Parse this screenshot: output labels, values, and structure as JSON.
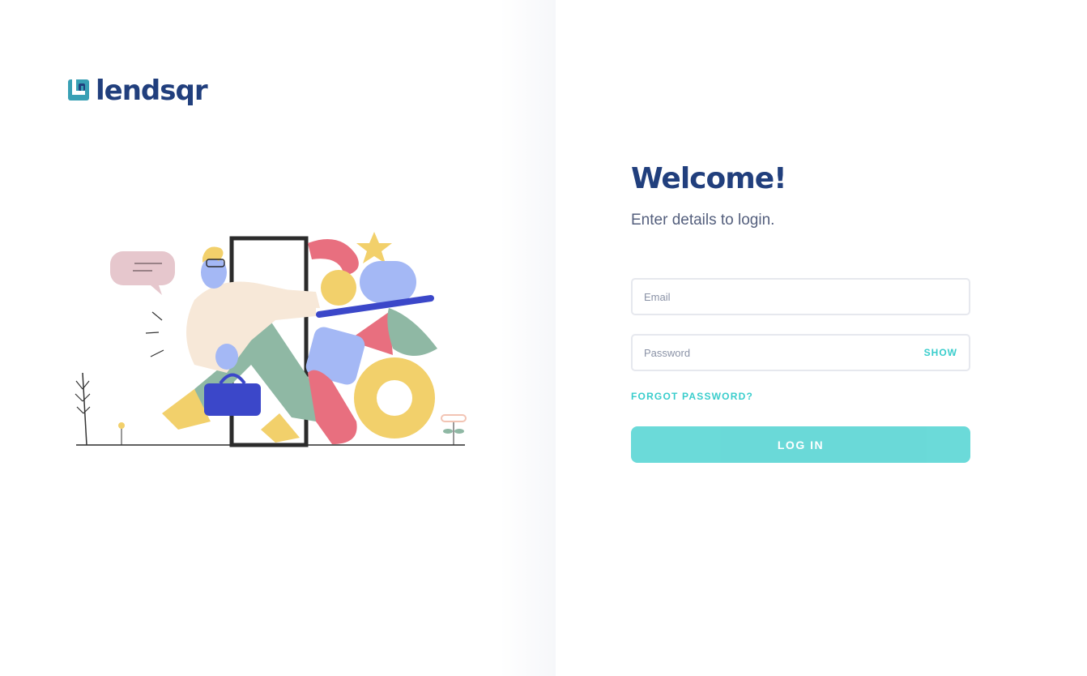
{
  "brand": {
    "name": "lendsqr",
    "primary_color": "#213F7D",
    "accent_color": "#39CDCC",
    "logo_icon": "lendsqr-logo-icon"
  },
  "illustration": {
    "icon": "person-entering-door-illustration"
  },
  "login": {
    "title": "Welcome!",
    "subtitle": "Enter details to login.",
    "email_placeholder": "Email",
    "password_placeholder": "Password",
    "show_label": "SHOW",
    "forgot_label": "FORGOT PASSWORD?",
    "submit_label": "LOG IN"
  }
}
